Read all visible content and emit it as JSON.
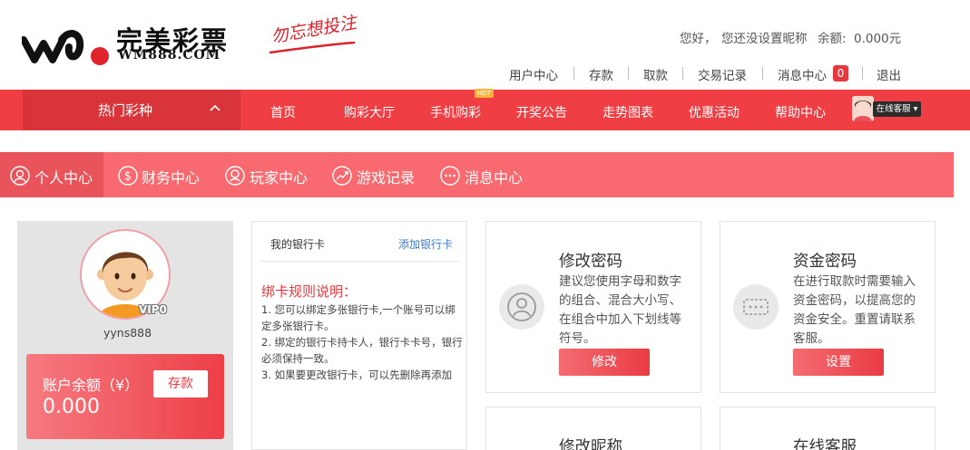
{
  "brand": {
    "logo_cn": "完美彩票",
    "logo_en": "WM888.COM",
    "slogan": "勿忘想投注",
    "accent_color": "#ef3e44"
  },
  "header": {
    "greeting": "您好，",
    "nickname_text": "您还没设置昵称",
    "balance_label": "余额:",
    "balance_value": "0.000元",
    "links": {
      "user_center": "用户中心",
      "deposit": "存款",
      "withdraw": "取款",
      "transactions": "交易记录",
      "messages": "消息中心",
      "messages_count": "0",
      "logout": "退出"
    }
  },
  "nav": {
    "hot_lottery": "热门彩种",
    "items": [
      "首页",
      "购彩大厅",
      "手机购彩",
      "开奖公告",
      "走势图表",
      "优惠活动",
      "帮助中心"
    ],
    "hot_tag": "HOT",
    "online_service": "在线客服"
  },
  "subnav": {
    "items": [
      "个人中心",
      "财务中心",
      "玩家中心",
      "游戏记录",
      "消息中心"
    ],
    "active": "个人中心"
  },
  "profile": {
    "vip": "VIP0",
    "username": "yyns888",
    "balance_label": "账户余额（¥）",
    "balance_value": "0.000",
    "deposit_button": "存款"
  },
  "bank": {
    "title": "我的银行卡",
    "add_link": "添加银行卡",
    "rules_title": "绑卡规则说明：",
    "rules": [
      "1. 您可以绑定多张银行卡,一个账号可以绑定多张银行卡。",
      "2. 绑定的银行卡持卡人，银行卡卡号，银行必须保持一致。",
      "3. 如果要更改银行卡，可以先删除再添加"
    ]
  },
  "cards": {
    "password": {
      "title": "修改密码",
      "desc": "建议您使用字母和数字的组合、混合大小写、在组合中加入下划线等符号。",
      "button": "修改"
    },
    "fund_password": {
      "title": "资金密码",
      "desc": "在进行取款时需要输入资金密码，以提高您的资金安全。重置请联系客服。",
      "button": "设置"
    },
    "nickname": {
      "title": "修改昵称"
    },
    "online_service": {
      "title": "在线客服"
    }
  }
}
